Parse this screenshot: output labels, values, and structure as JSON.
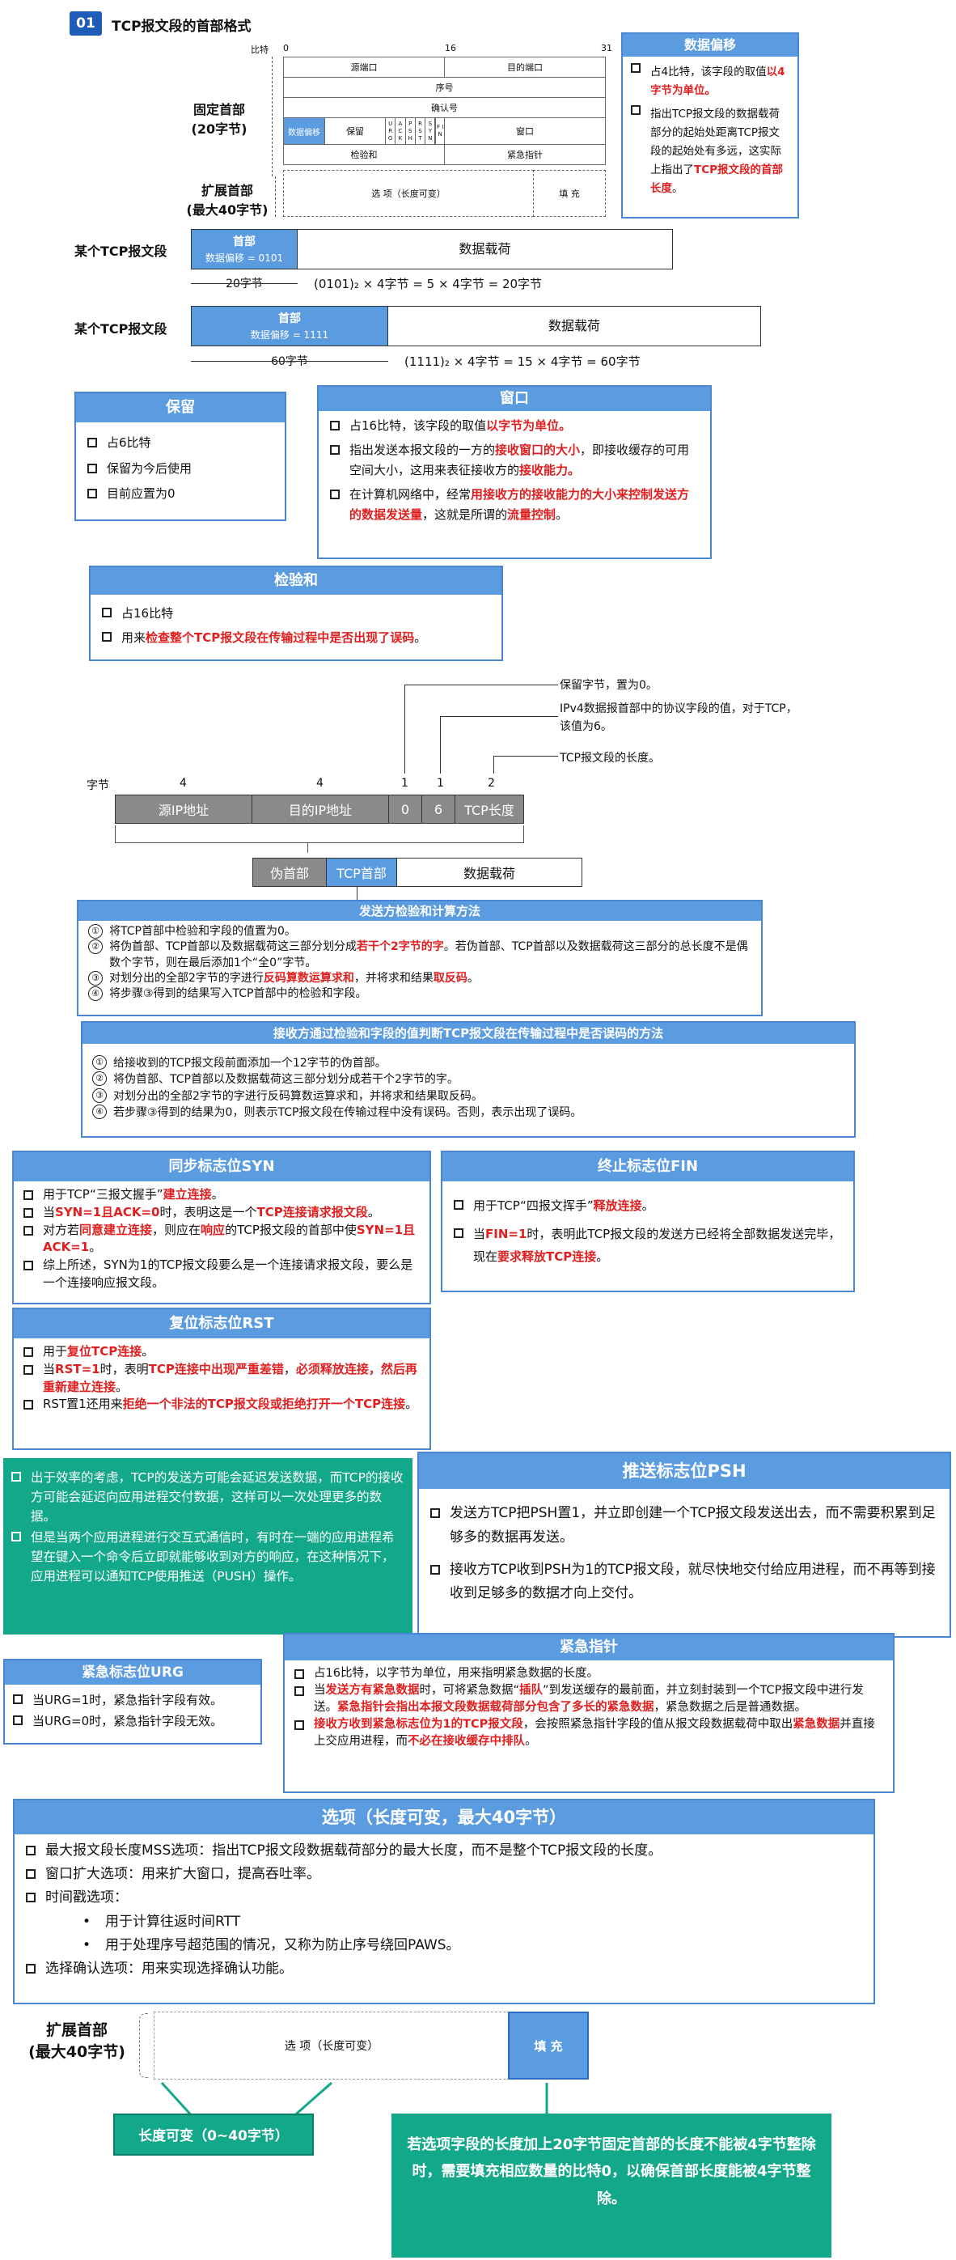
{
  "section_badge": "01",
  "section_title": "TCP报文段的首部格式",
  "header_diagram": {
    "bit_label": "比特",
    "bit_0": "0",
    "bit_16": "16",
    "bit_31": "31",
    "fixed_label": "固定首部",
    "fixed_sub": "(20字节)",
    "ext_label": "扩展首部",
    "ext_sub": "(最大40字节)",
    "src_port": "源端口",
    "dst_port": "目的端口",
    "seq": "序号",
    "ack": "确认号",
    "data_offset": "数据偏移",
    "reserved": "保留",
    "flags": [
      "U R G",
      "A C K",
      "P S H",
      "R S T",
      "S Y N",
      "F I N"
    ],
    "window": "窗口",
    "checksum": "检验和",
    "urgent_ptr": "紧急指针",
    "options": "选 项（长度可变）",
    "padding": "填 充"
  },
  "data_offset_box": {
    "title": "数据偏移",
    "p1a": "占4比特，该字段的取值",
    "p1b": "以4字节为单位。",
    "p2a": "指出TCP报文段的数据载荷部分的起始处距离TCP报文段的起始处有多远，这实际上指出了",
    "p2b": "TCP报文段的首部长度",
    "p2c": "。"
  },
  "example1": {
    "label": "某个TCP报文段",
    "header": "首部",
    "sub": "数据偏移 = 0101",
    "payload": "数据载荷",
    "size": "20字节",
    "formula": "(0101)₂ × 4字节 = 5 × 4字节 = 20字节"
  },
  "example2": {
    "label": "某个TCP报文段",
    "header": "首部",
    "sub": "数据偏移 = 1111",
    "payload": "数据载荷",
    "size": "60字节",
    "formula": "(1111)₂ × 4字节 = 15 × 4字节 = 60字节"
  },
  "reserved_box": {
    "title": "保留",
    "items": [
      "占6比特",
      "保留为今后使用",
      "目前应置为0"
    ]
  },
  "window_box": {
    "title": "窗口",
    "i1a": "占16比特，该字段的取值",
    "i1b": "以字节为单位。",
    "i2a": "指出发送本报文段的一方的",
    "i2b": "接收窗口的大小",
    "i2c": "，即接收缓存的可用空间大小，这用来表征接收方的",
    "i2d": "接收能力。",
    "i3a": "在计算机网络中，经常",
    "i3b": "用接收方的接收能力的大小来控制发送方的数据发送量",
    "i3c": "，这就是所谓的",
    "i3d": "流量控制",
    "i3e": "。"
  },
  "checksum_box": {
    "title": "检验和",
    "i1": "占16比特",
    "i2a": "用来",
    "i2b": "检查整个TCP报文段在传输过程中是否出现了误码",
    "i2c": "。"
  },
  "pseudo": {
    "note1": "保留字节，置为0。",
    "note2": "IPv4数据报首部中的协议字段的值，对于TCP，该值为6。",
    "note3": "TCP报文段的长度。",
    "bytes_label": "字节",
    "b4a": "4",
    "b4b": "4",
    "b1a": "1",
    "b1b": "1",
    "b2": "2",
    "src_ip": "源IP地址",
    "dst_ip": "目的IP地址",
    "zero": "0",
    "six": "6",
    "tcp_len": "TCP长度",
    "pseudo_hdr": "伪首部",
    "tcp_hdr": "TCP首部",
    "payload": "数据载荷"
  },
  "sender_box": {
    "title": "发送方检验和计算方法",
    "s1": "将TCP首部中检验和字段的值置为0。",
    "s2a": "将伪首部、TCP首部以及数据载荷这三部分划分成",
    "s2b": "若干个2字节的字",
    "s2c": "。若伪首部、TCP首部以及数据载荷这三部分的总长度不是偶数个字节，则在最后添加1个“全0”字节。",
    "s3a": "对划分出的全部2字节的字进行",
    "s3b": "反码算数运算求和",
    "s3c": "，并将求和结果",
    "s3d": "取反码",
    "s3e": "。",
    "s4": "将步骤③得到的结果写入TCP首部中的检验和字段。",
    "n1": "①",
    "n2": "②",
    "n3": "③",
    "n4": "④"
  },
  "receiver_box": {
    "title": "接收方通过检验和字段的值判断TCP报文段在传输过程中是否误码的方法",
    "s1": "给接收到的TCP报文段前面添加一个12字节的伪首部。",
    "s2": "将伪首部、TCP首部以及数据载荷这三部分划分成若干个2字节的字。",
    "s3": "对划分出的全部2字节的字进行反码算数运算求和，并将求和结果取反码。",
    "s4": "若步骤③得到的结果为0，则表示TCP报文段在传输过程中没有误码。否则，表示出现了误码。",
    "n1": "①",
    "n2": "②",
    "n3": "③",
    "n4": "④"
  },
  "syn_box": {
    "title": "同步标志位SYN",
    "i1a": "用于TCP“三报文握手”",
    "i1b": "建立连接",
    "i1c": "。",
    "i2a": "当",
    "i2b": "SYN=1且ACK=0",
    "i2c": "时，表明这是一个",
    "i2d": "TCP连接请求报文段",
    "i2e": "。",
    "i3a": "对方若",
    "i3b": "同意建立连接",
    "i3c": "，则应在",
    "i3d": "响应",
    "i3e": "的TCP报文段的首部中使",
    "i3f": "SYN=1且ACK=1",
    "i3g": "。",
    "i4": "综上所述，SYN为1的TCP报文段要么是一个连接请求报文段，要么是一个连接响应报文段。"
  },
  "fin_box": {
    "title": "终止标志位FIN",
    "i1a": "用于TCP“四报文挥手”",
    "i1b": "释放连接",
    "i1c": "。",
    "i2a": "当",
    "i2b": "FIN=1",
    "i2c": "时，表明此TCP报文段的发送方已经将全部数据发送完毕，现在",
    "i2d": "要求释放TCP连接",
    "i2e": "。"
  },
  "rst_box": {
    "title": "复位标志位RST",
    "i1a": "用于",
    "i1b": "复位TCP连接",
    "i1c": "。",
    "i2a": "当",
    "i2b": "RST=1",
    "i2c": "时，表明",
    "i2d": "TCP连接中出现严重差错",
    "i2e": "，",
    "i2f": "必须释放连接，然后再重新建立连接",
    "i2g": "。",
    "i3a": "RST置1还用来",
    "i3b": "拒绝一个非法的TCP报文段或拒绝打开一个TCP连接",
    "i3c": "。"
  },
  "green_note": {
    "p1": "出于效率的考虑，TCP的发送方可能会延迟发送数据，而TCP的接收方可能会延迟向应用进程交付数据，这样可以一次处理更多的数据。",
    "p2": "但是当两个应用进程进行交互式通信时，有时在一端的应用进程希望在键入一个命令后立即就能够收到对方的响应，在这种情况下，应用进程可以通知TCP使用推送（PUSH）操作。"
  },
  "psh_box": {
    "title": "推送标志位PSH",
    "i1": "发送方TCP把PSH置1，并立即创建一个TCP报文段发送出去，而不需要积累到足够多的数据再发送。",
    "i2": "接收方TCP收到PSH为1的TCP报文段，就尽快地交付给应用进程，而不再等到接收到足够多的数据才向上交付。"
  },
  "urgptr_box": {
    "title": "紧急指针",
    "i1": "占16比特，以字节为单位，用来指明紧急数据的长度。",
    "i2a": "当",
    "i2b": "发送方有紧急数据",
    "i2c": "时，可将紧急数据“",
    "i2d": "插队",
    "i2e": "”到发送缓存的最前面，并立刻封装到一个TCP报文段中进行发送。",
    "i2f": "紧急指针会指出本报文段数据载荷部分包含了多长的紧急数据",
    "i2g": "，紧急数据之后是普通数据。",
    "i3a": "接收方收到紧急标志位为1的TCP报文段",
    "i3b": "，会按照紧急指针字段的值从报文段数据载荷中取出",
    "i3c": "紧急数据",
    "i3d": "并直接上交应用进程，而",
    "i3e": "不必在接收缓存中排队",
    "i3f": "。"
  },
  "urg_box": {
    "title": "紧急标志位URG",
    "i1": "当URG=1时，紧急指针字段有效。",
    "i2": "当URG=0时，紧急指针字段无效。"
  },
  "options_box": {
    "title": "选项（长度可变，最大40字节）",
    "i1": "最大报文段长度MSS选项：指出TCP报文段数据载荷部分的最大长度，而不是整个TCP报文段的长度。",
    "i2": "窗口扩大选项：用来扩大窗口，提高吞吐率。",
    "i3": "时间戳选项：",
    "b1": "用于计算往返时间RTT",
    "b2": "用于处理序号超范围的情况，又称为防止序号绕回PAWS。",
    "i4": "选择确认选项：用来实现选择确认功能。"
  },
  "bottom": {
    "ext_label": "扩展首部",
    "ext_sub": "(最大40字节)",
    "options": "选 项（长度可变）",
    "padding": "填 充",
    "len_note": "长度可变（0~40字节）",
    "pad_note": "若选项字段的长度加上20字节固定首部的长度不能被4字节整除时，需要填充相应数量的比特0，以确保首部长度能被4字节整除。"
  }
}
